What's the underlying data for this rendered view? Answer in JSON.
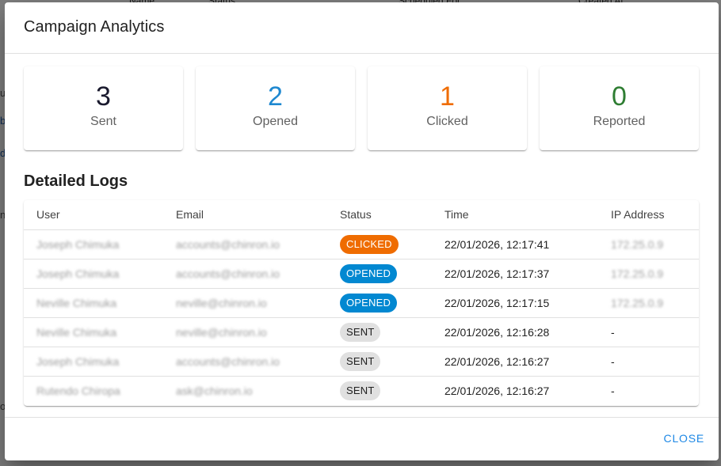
{
  "background": {
    "header_cols": [
      "Name",
      "Status",
      "Scheduled For",
      "Created At"
    ],
    "side_fragments": [
      "u",
      "b",
      "d",
      "n",
      "o"
    ]
  },
  "dialog": {
    "title": "Campaign Analytics",
    "close_label": "CLOSE"
  },
  "stats": [
    {
      "value": "3",
      "label": "Sent",
      "color": "#1a1a2e"
    },
    {
      "value": "2",
      "label": "Opened",
      "color": "#1e88d0"
    },
    {
      "value": "1",
      "label": "Clicked",
      "color": "#ef6c00"
    },
    {
      "value": "0",
      "label": "Reported",
      "color": "#2e7d32"
    }
  ],
  "logs": {
    "title": "Detailed Logs",
    "headers": [
      "User",
      "Email",
      "Status",
      "Time",
      "IP Address"
    ],
    "rows": [
      {
        "user": "Joseph Chimuka",
        "email": "accounts@chinron.io",
        "status": "CLICKED",
        "time": "22/01/2026, 12:17:41",
        "ip": "172.25.0.9"
      },
      {
        "user": "Joseph Chimuka",
        "email": "accounts@chinron.io",
        "status": "OPENED",
        "time": "22/01/2026, 12:17:37",
        "ip": "172.25.0.9"
      },
      {
        "user": "Neville Chimuka",
        "email": "neville@chinron.io",
        "status": "OPENED",
        "time": "22/01/2026, 12:17:15",
        "ip": "172.25.0.9"
      },
      {
        "user": "Neville Chimuka",
        "email": "neville@chinron.io",
        "status": "SENT",
        "time": "22/01/2026, 12:16:28",
        "ip": "-"
      },
      {
        "user": "Joseph Chimuka",
        "email": "accounts@chinron.io",
        "status": "SENT",
        "time": "22/01/2026, 12:16:27",
        "ip": "-"
      },
      {
        "user": "Rutendo Chiropa",
        "email": "ask@chinron.io",
        "status": "SENT",
        "time": "22/01/2026, 12:16:27",
        "ip": "-"
      }
    ]
  },
  "status_colors": {
    "CLICKED": {
      "bg": "#ef6c00",
      "fg": "#ffffff"
    },
    "OPENED": {
      "bg": "#0288d1",
      "fg": "#ffffff"
    },
    "SENT": {
      "bg": "#e0e0e0",
      "fg": "#212121"
    }
  }
}
